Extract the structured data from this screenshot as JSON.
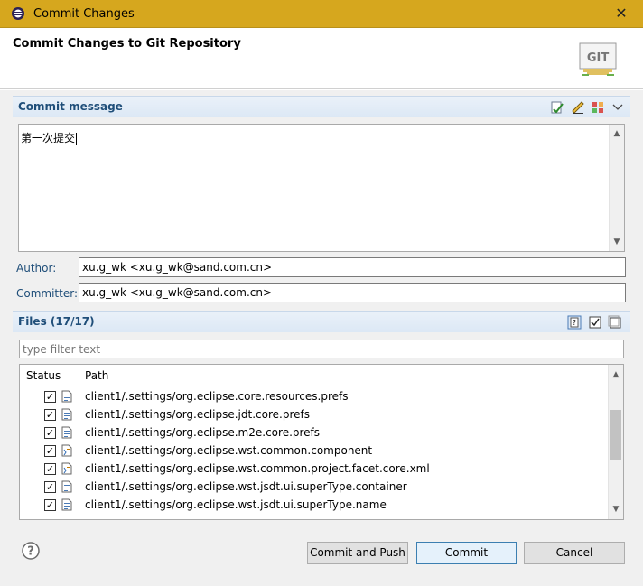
{
  "window": {
    "title": "Commit Changes",
    "close_glyph": "✕"
  },
  "header": {
    "heading": "Commit Changes to Git Repository",
    "logo_text": "GIT"
  },
  "commit_message": {
    "section_title": "Commit message",
    "text": "第一次提交"
  },
  "author": {
    "label": "Author:",
    "value": "xu.g_wk <xu.g_wk@sand.com.cn>"
  },
  "committer": {
    "label": "Committer:",
    "value": "xu.g_wk <xu.g_wk@sand.com.cn>"
  },
  "files": {
    "section_title": "Files (17/17)",
    "filter_placeholder": "type filter text",
    "columns": [
      "Status",
      "Path"
    ],
    "rows": [
      {
        "path": "client1/.settings/org.eclipse.core.resources.prefs",
        "checked": true,
        "icon": "prefs-file-icon"
      },
      {
        "path": "client1/.settings/org.eclipse.jdt.core.prefs",
        "checked": true,
        "icon": "prefs-file-icon"
      },
      {
        "path": "client1/.settings/org.eclipse.m2e.core.prefs",
        "checked": true,
        "icon": "prefs-file-icon"
      },
      {
        "path": "client1/.settings/org.eclipse.wst.common.component",
        "checked": true,
        "icon": "xml-file-icon"
      },
      {
        "path": "client1/.settings/org.eclipse.wst.common.project.facet.core.xml",
        "checked": true,
        "icon": "xml-file-icon"
      },
      {
        "path": "client1/.settings/org.eclipse.wst.jsdt.ui.superType.container",
        "checked": true,
        "icon": "prefs-file-icon"
      },
      {
        "path": "client1/.settings/org.eclipse.wst.jsdt.ui.superType.name",
        "checked": true,
        "icon": "prefs-file-icon"
      }
    ]
  },
  "buttons": {
    "commit_and_push": "Commit and Push",
    "commit": "Commit",
    "cancel": "Cancel"
  },
  "colors": {
    "titlebar": "#d6a71e",
    "section_title": "#1f4e79",
    "primary_button_border": "#3c7fb1"
  }
}
